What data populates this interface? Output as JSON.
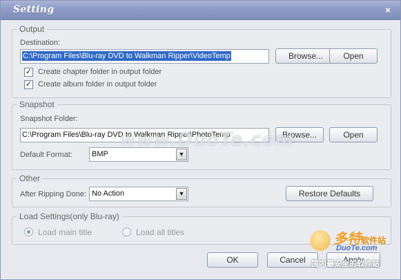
{
  "window": {
    "title": "Setting",
    "close_glyph": "×"
  },
  "output": {
    "legend": "Output",
    "destination_label": "Destination:",
    "destination_value": "C:\\Program Files\\Blu-ray DVD to Walkman Ripper\\VideoTemp",
    "browse_label": "Browse...",
    "open_label": "Open",
    "chapter_folder_label": "Create chapter folder in output folder",
    "chapter_folder_checked": true,
    "album_folder_label": "Create album folder in output folder",
    "album_folder_checked": true
  },
  "snapshot": {
    "legend": "Snapshot",
    "folder_label": "Snapshot Folder:",
    "folder_value": "C:\\Program Files\\Blu-ray DVD to Walkman Ripper\\PhotoTemp",
    "browse_label": "Browse...",
    "open_label": "Open",
    "format_label": "Default Format:",
    "format_value": "BMP"
  },
  "other": {
    "legend": "Other",
    "after_ripping_label": "After Ripping Done:",
    "after_ripping_value": "No Action",
    "restore_label": "Restore Defaults"
  },
  "load_settings": {
    "legend": "Load Settings(only Blu-ray)",
    "load_main_label": "Load main title",
    "load_main_selected": true,
    "load_all_label": "Load all titles",
    "load_all_selected": false
  },
  "footer": {
    "ok_label": "OK",
    "cancel_label": "Cancel",
    "apply_label": "Apply"
  },
  "watermark": {
    "text": "www.DuoTe.com",
    "logo_zh": "多特",
    "logo_zh_small": "软件站",
    "logo_url": "DuoTe.com",
    "logo_sub": "国内最安全的软件站"
  },
  "icons": {
    "close": "close-icon",
    "checkmark": "checkmark-icon",
    "dropdown": "chevron-down-icon"
  },
  "colors": {
    "title_bar": "#8e9cc6",
    "selection": "#316ac5",
    "window_bg": "#e8e9ee"
  }
}
